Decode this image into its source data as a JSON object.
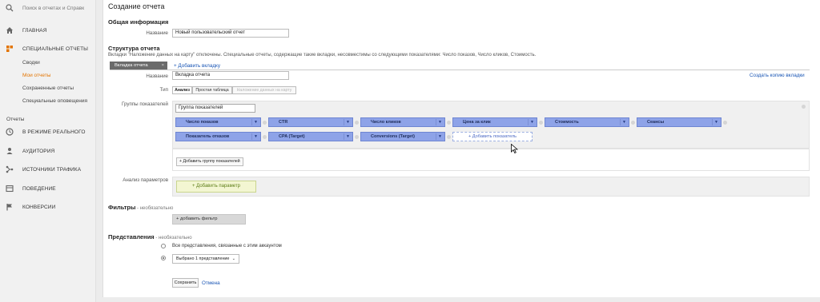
{
  "sidebar": {
    "search_placeholder": "Поиск в отчетах и Справк",
    "home": "ГЛАВНАЯ",
    "custom_reports": "СПЕЦИАЛЬНЫЕ ОТЧЕТЫ",
    "sub_items": [
      "Сводки",
      "Мои отчеты",
      "Сохраненные отчеты",
      "Специальные оповещения"
    ],
    "reports_label": "Отчеты",
    "nav": [
      "В РЕЖИМЕ РЕАЛЬНОГО",
      "АУДИТОРИЯ",
      "ИСТОЧНИКИ ТРАФИКА",
      "ПОВЕДЕНИЕ",
      "КОНВЕРСИИ"
    ],
    "active_color": "#e37400"
  },
  "page": {
    "title": "Создание отчета",
    "general_info": "Общая информация",
    "name_label": "Название",
    "name_value": "Новый пользовательский отчет",
    "structure_title": "Структура отчета",
    "structure_note": "Вкладки \"Наложение данных на карту\" отключены. Специальные отчеты, содержащие такие вкладки, несовместимы со следующими показателями: Число показов, Число кликов, Стоимость.",
    "tab_name": "Вкладка отчета",
    "tab_close": "×",
    "add_tab": "+ Добавить вкладку",
    "tab_name_label": "Название",
    "tab_name_value": "Вкладка отчета",
    "copy_tab": "Создать копию вкладки",
    "type_label": "Тип",
    "types": [
      "Анализ",
      "Простая таблица",
      "Наложение данных на карту"
    ],
    "metric_groups_label": "Группы показателей",
    "group_name": "Группа показателей",
    "metrics_row1": [
      "Число показов",
      "CTR",
      "Число кликов",
      "Цена за клик",
      "Стоимость",
      "Сеансы"
    ],
    "metrics_row2": [
      "Показатель отказов",
      "CPA (Target)",
      "Conversions (Target)"
    ],
    "add_metric": "+ Добавить показатель",
    "add_group": "+ Добавить группу показателей",
    "params_label": "Анализ параметров",
    "add_param": "+ Добавить параметр",
    "filters_title": "Фильтры",
    "filters_optional": " - необязательно",
    "add_filter": "+ добавить фильтр",
    "views_title": "Представления",
    "views_optional": " - необязательно",
    "all_views": "Все представления, связанные с этим аккаунтом",
    "selected_views": "Выбрано 1 представление",
    "save": "Сохранить",
    "cancel": "Отмена",
    "chip_color": "#8ea3e8"
  }
}
